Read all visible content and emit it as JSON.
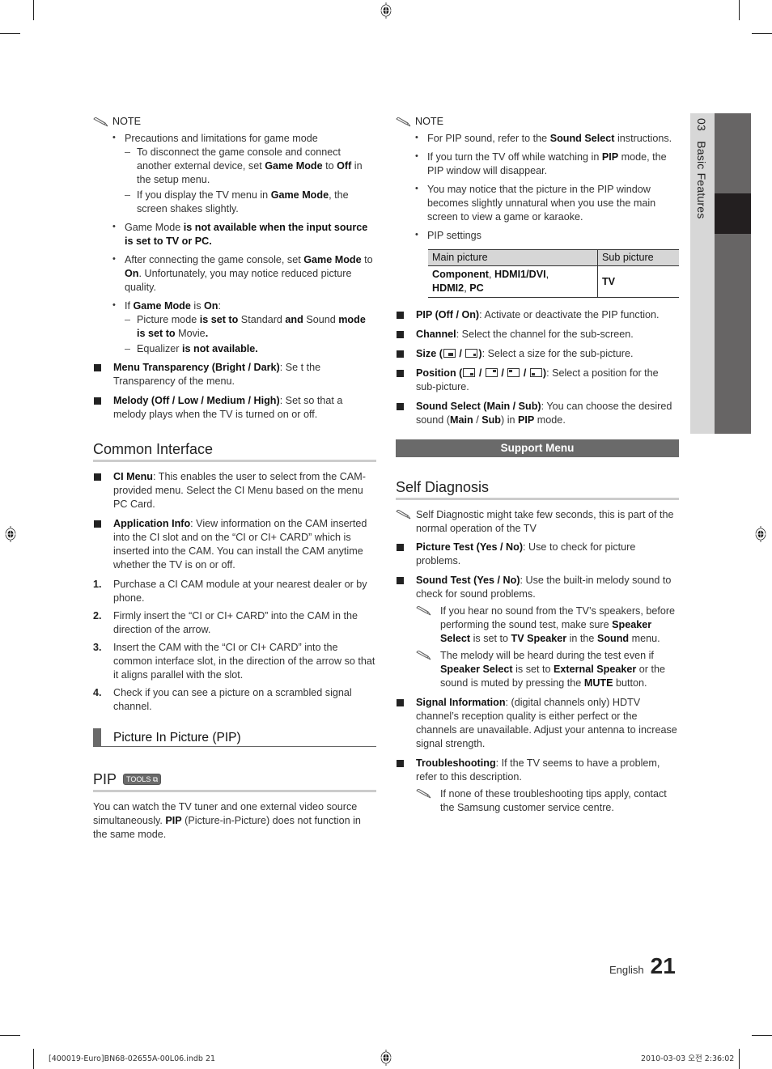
{
  "side_tab": {
    "chapter_number": "03",
    "chapter_title": "Basic Features"
  },
  "left": {
    "note1": {
      "label": "NOTE",
      "items": [
        {
          "text": "Precautions and limitations for game mode",
          "subs": [
            {
              "parts": [
                "To disconnect the game console and connect another external device, set ",
                "Game Mode",
                " to ",
                "Off",
                " in the setup menu."
              ]
            },
            {
              "parts": [
                "If you display the TV menu in ",
                "Game Mode",
                ", the screen shakes slightly."
              ]
            }
          ]
        },
        {
          "parts": [
            "Game Mode",
            " is not available when the input source is set to TV or PC."
          ]
        },
        {
          "parts": [
            "After connecting the game console, set ",
            "Game Mode",
            " to ",
            "On",
            ". Unfortunately, you may notice reduced picture quality."
          ]
        },
        {
          "parts": [
            "If ",
            "Game Mode",
            " is ",
            "On",
            ":"
          ],
          "subs": [
            {
              "parts": [
                "Picture mode",
                " is set to ",
                "Standard",
                " and ",
                "Sound",
                " mode is set to ",
                "Movie",
                "."
              ]
            },
            {
              "parts": [
                "Equalizer",
                " is not available."
              ]
            }
          ]
        }
      ]
    },
    "menu_items": [
      {
        "label": "Menu Transparency (Bright / Dark)",
        "desc": ": Se t the Transparency of the menu."
      },
      {
        "label": "Melody (Off / Low / Medium / High)",
        "desc": ": Set so that a melody plays when the TV is turned on or off."
      }
    ],
    "common_interface": {
      "title": "Common Interface",
      "items": [
        {
          "label": "CI Menu",
          "desc": ":  This enables the user to select from the CAM-provided menu. Select the CI Menu based on the menu PC Card."
        },
        {
          "label": "Application Info",
          "desc": ": View information on the CAM inserted into the CI slot and on the “CI or CI+ CARD” which is inserted into the CAM. You can install the CAM anytime whether the TV is on or off."
        }
      ],
      "steps": [
        {
          "num": "1.",
          "text": "Purchase a CI CAM module at your nearest dealer or by phone."
        },
        {
          "num": "2.",
          "text": "Firmly insert the “CI or CI+ CARD” into the CAM in the direction of the arrow."
        },
        {
          "num": "3.",
          "text": "Insert the CAM with the “CI or CI+ CARD” into the common interface slot, in the direction of the arrow so that it aligns parallel with the slot."
        },
        {
          "num": "4.",
          "text": "Check if you can see a picture on a scrambled signal channel."
        }
      ]
    },
    "pip_section": {
      "subheading": "Picture In Picture (PIP)",
      "title": "PIP",
      "tools_badge": "TOOLS",
      "body_parts": [
        "You can watch the TV tuner and one external video source simultaneously. ",
        "PIP",
        " (Picture-in-Picture) does not function in the same mode."
      ]
    }
  },
  "right": {
    "note2": {
      "label": "NOTE",
      "items": [
        {
          "parts": [
            "For PIP sound, refer to the ",
            "Sound Select",
            " instructions."
          ]
        },
        {
          "parts": [
            "If you turn the TV off while watching in ",
            "PIP",
            " mode, the PIP window will disappear."
          ]
        },
        {
          "parts": [
            "You may notice that the picture in the PIP window becomes slightly unnatural when you use the main screen to view a game or karaoke."
          ]
        },
        {
          "parts": [
            "PIP settings"
          ]
        }
      ]
    },
    "pip_table": {
      "headers": [
        "Main picture",
        "Sub picture"
      ],
      "rows": [
        {
          "main_parts": [
            "Component",
            ", ",
            "HDMI1/DVI",
            ",",
            "HDMI2",
            ", ",
            "PC"
          ],
          "sub": "TV"
        }
      ]
    },
    "pip_items": [
      {
        "label": "PIP (Off / On)",
        "desc": ": Activate or deactivate the PIP function."
      },
      {
        "label": "Channel",
        "desc": ": Select the channel for the sub-screen."
      },
      {
        "label": "Size (",
        "sep": " / ",
        "after": "): ",
        "desc": "Select a size for the sub-picture.",
        "icons": [
          "size-large-icon",
          "size-small-icon"
        ]
      },
      {
        "label": "Position (",
        "sep": " / ",
        "after": "): ",
        "desc": "Select a position for the sub-picture.",
        "icons": [
          "position-bottom-right-icon",
          "position-top-right-icon",
          "position-top-left-icon",
          "position-bottom-left-icon"
        ]
      },
      {
        "label": "Sound Select (Main / Sub)",
        "desc_parts": [
          ": You can choose the desired sound (",
          "Main",
          " / ",
          "Sub",
          ") in ",
          "PIP",
          " mode."
        ]
      }
    ],
    "support_menu": "Support Menu",
    "self_diagnosis": {
      "title": "Self Diagnosis",
      "intro": "Self Diagnostic might take few seconds, this is part of the normal operation of the TV",
      "items": [
        {
          "label": "Picture Test (Yes / No)",
          "desc": ": Use to check for picture problems."
        },
        {
          "label": "Sound Test (Yes / No)",
          "desc": ": Use the built-in melody sound to check for sound problems.",
          "notes": [
            {
              "parts": [
                "If you hear no sound from the TV’s speakers, before performing the sound test, make sure ",
                "Speaker Select",
                " is set to ",
                "TV Speaker",
                " in the ",
                "Sound",
                " menu."
              ]
            },
            {
              "parts": [
                "The melody will be heard during the test even if ",
                "Speaker Select",
                " is set to ",
                "External Speaker",
                " or the sound is muted by pressing the ",
                "MUTE",
                " button."
              ]
            }
          ]
        },
        {
          "label": "Signal Information",
          "desc": ": (digital channels only) HDTV channel’s reception quality is either perfect or the channels are unavailable. Adjust your antenna to increase signal strength."
        },
        {
          "label": "Troubleshooting",
          "desc": ": If the TV seems to have a problem, refer to this description.",
          "notes": [
            {
              "parts": [
                " If none of these troubleshooting tips apply, contact the Samsung customer service centre."
              ]
            }
          ]
        }
      ]
    }
  },
  "page_footer": {
    "language": "English",
    "page_number": "21"
  },
  "print_slug": {
    "file": "[400019-Euro]BN68-02655A-00L06.indb   21",
    "timestamp": "2010-03-03   오전 2:36:02"
  }
}
